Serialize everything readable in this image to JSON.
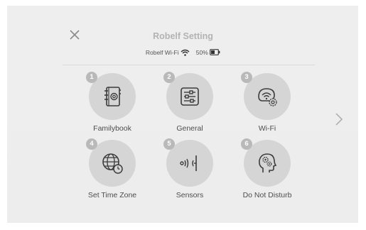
{
  "header": {
    "title": "Robelf Setting",
    "close_icon": "close-icon"
  },
  "status": {
    "wifi_name": "Robelf Wi-Fi",
    "battery_level": "50%",
    "wifi_icon": "wifi-icon",
    "battery_icon": "battery-icon"
  },
  "menu": {
    "items": [
      {
        "number": "1",
        "label": "Familybook",
        "icon": "address-book-icon"
      },
      {
        "number": "2",
        "label": "General",
        "icon": "sliders-icon"
      },
      {
        "number": "3",
        "label": "Wi-Fi",
        "icon": "wifi-settings-icon"
      },
      {
        "number": "4",
        "label": "Set Time Zone",
        "icon": "globe-clock-icon"
      },
      {
        "number": "5",
        "label": "Sensors",
        "icon": "sensor-waves-icon"
      },
      {
        "number": "6",
        "label": "Do Not Disturb",
        "icon": "head-gears-icon"
      }
    ]
  },
  "navigation": {
    "next_icon": "chevron-right-icon"
  },
  "colors": {
    "background": "#eeeeee",
    "circle": "#d5d5d5",
    "badge": "#b9b9b9",
    "icon_stroke": "#3c3c3c",
    "title": "#b3b3b3"
  }
}
